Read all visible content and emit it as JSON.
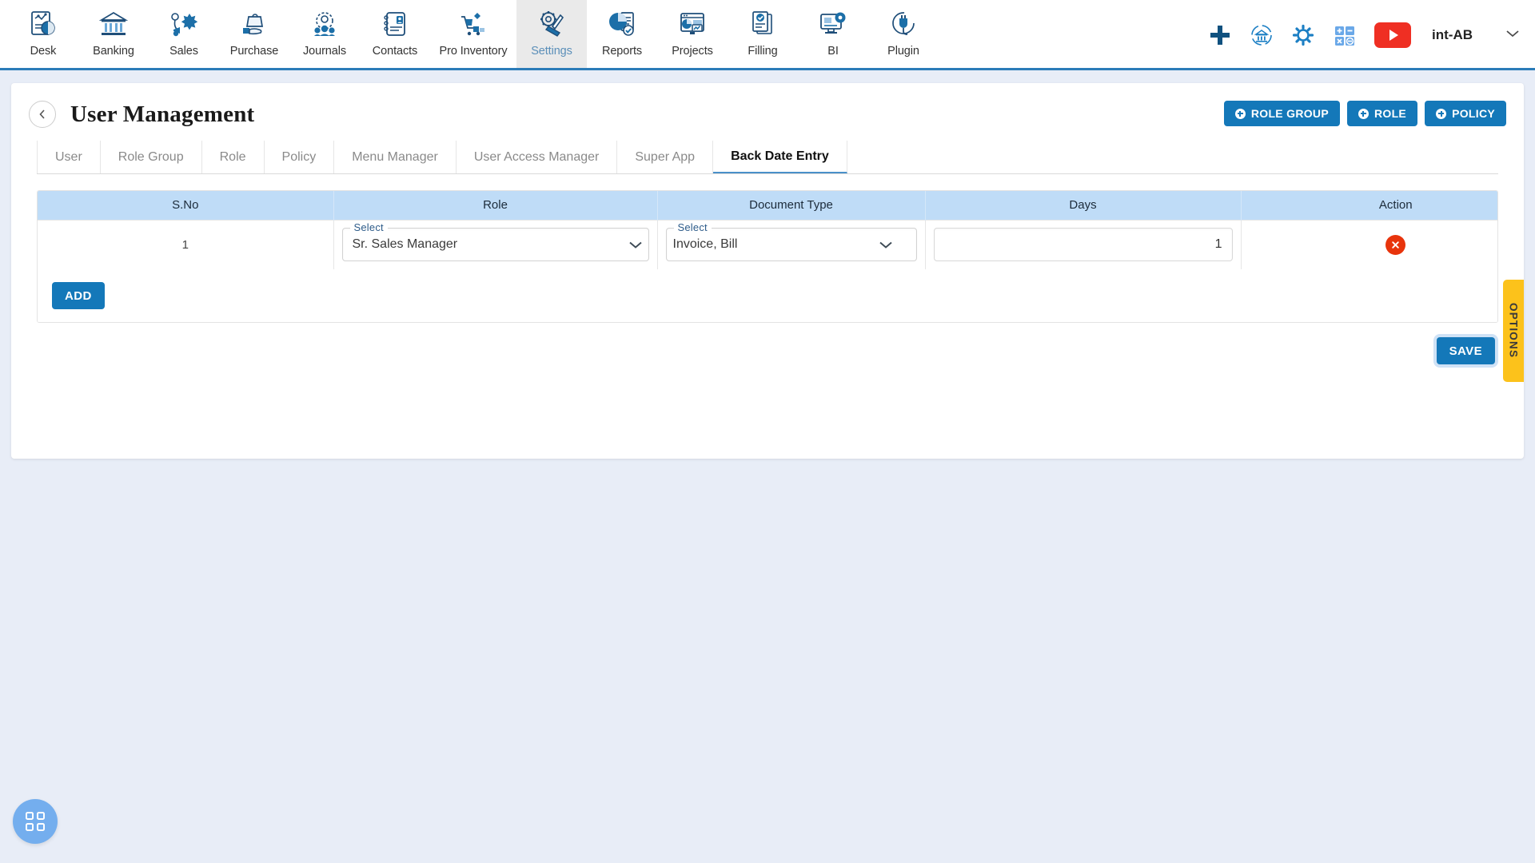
{
  "topnav": {
    "items": [
      {
        "label": "Desk",
        "icon": "desk-chart-icon",
        "active": false
      },
      {
        "label": "Banking",
        "icon": "bank-building-icon",
        "active": false
      },
      {
        "label": "Sales",
        "icon": "megaphone-burst-icon",
        "active": false
      },
      {
        "label": "Purchase",
        "icon": "bag-hand-icon",
        "active": false
      },
      {
        "label": "Journals",
        "icon": "people-gear-icon",
        "active": false
      },
      {
        "label": "Contacts",
        "icon": "contact-book-icon",
        "active": false
      },
      {
        "label": "Pro Inventory",
        "icon": "cart-boxes-icon",
        "active": false
      },
      {
        "label": "Settings",
        "icon": "gear-wrench-icon",
        "active": true
      },
      {
        "label": "Reports",
        "icon": "pie-report-icon",
        "active": false
      },
      {
        "label": "Projects",
        "icon": "dashboard-window-icon",
        "active": false
      },
      {
        "label": "Filling",
        "icon": "documents-check-icon",
        "active": false
      },
      {
        "label": "BI",
        "icon": "monitor-gear-icon",
        "active": false
      },
      {
        "label": "Plugin",
        "icon": "plug-icon",
        "active": false
      }
    ],
    "right": {
      "add_icon": "plus-icon",
      "bank_sync_icon": "bank-refresh-icon",
      "settings_icon": "gear-icon",
      "calculator_icon": "calculator-icon",
      "video_icon": "youtube-play-icon",
      "user_label": "int-AB",
      "caret_icon": "chevron-down-icon"
    }
  },
  "page": {
    "back_icon": "chevron-left-icon",
    "title": "User Management",
    "actions": [
      {
        "label": "ROLE GROUP",
        "icon": "plus-circle-icon"
      },
      {
        "label": "ROLE",
        "icon": "plus-circle-icon"
      },
      {
        "label": "POLICY",
        "icon": "plus-circle-icon"
      }
    ]
  },
  "tabs": [
    {
      "label": "User",
      "active": false
    },
    {
      "label": "Role Group",
      "active": false
    },
    {
      "label": "Role",
      "active": false
    },
    {
      "label": "Policy",
      "active": false
    },
    {
      "label": "Menu Manager",
      "active": false
    },
    {
      "label": "User Access Manager",
      "active": false
    },
    {
      "label": "Super App",
      "active": false
    },
    {
      "label": "Back Date Entry",
      "active": true
    }
  ],
  "table": {
    "headers": [
      "S.No",
      "Role",
      "Document Type",
      "Days",
      "Action"
    ],
    "rows": [
      {
        "sno": "1",
        "role_legend": "Select",
        "role_value": "Sr. Sales Manager",
        "doc_legend": "Select",
        "doc_value": "Invoice, Bill",
        "days_value": "1",
        "days_placeholder": "",
        "action_icon": "delete-circle-icon"
      }
    ]
  },
  "buttons": {
    "add_label": "ADD",
    "save_label": "SAVE"
  },
  "options_tab": {
    "label": "OPTIONS",
    "color": "#fcc21b"
  },
  "fab": {
    "icon": "grid-apps-icon"
  },
  "colors": {
    "accent_blue": "#1478b9",
    "header_blue": "#bfdcf7",
    "danger_red": "#e8340c",
    "amber": "#fcc21b",
    "fab_blue": "#74aeee",
    "page_bg": "#e8edf7"
  }
}
